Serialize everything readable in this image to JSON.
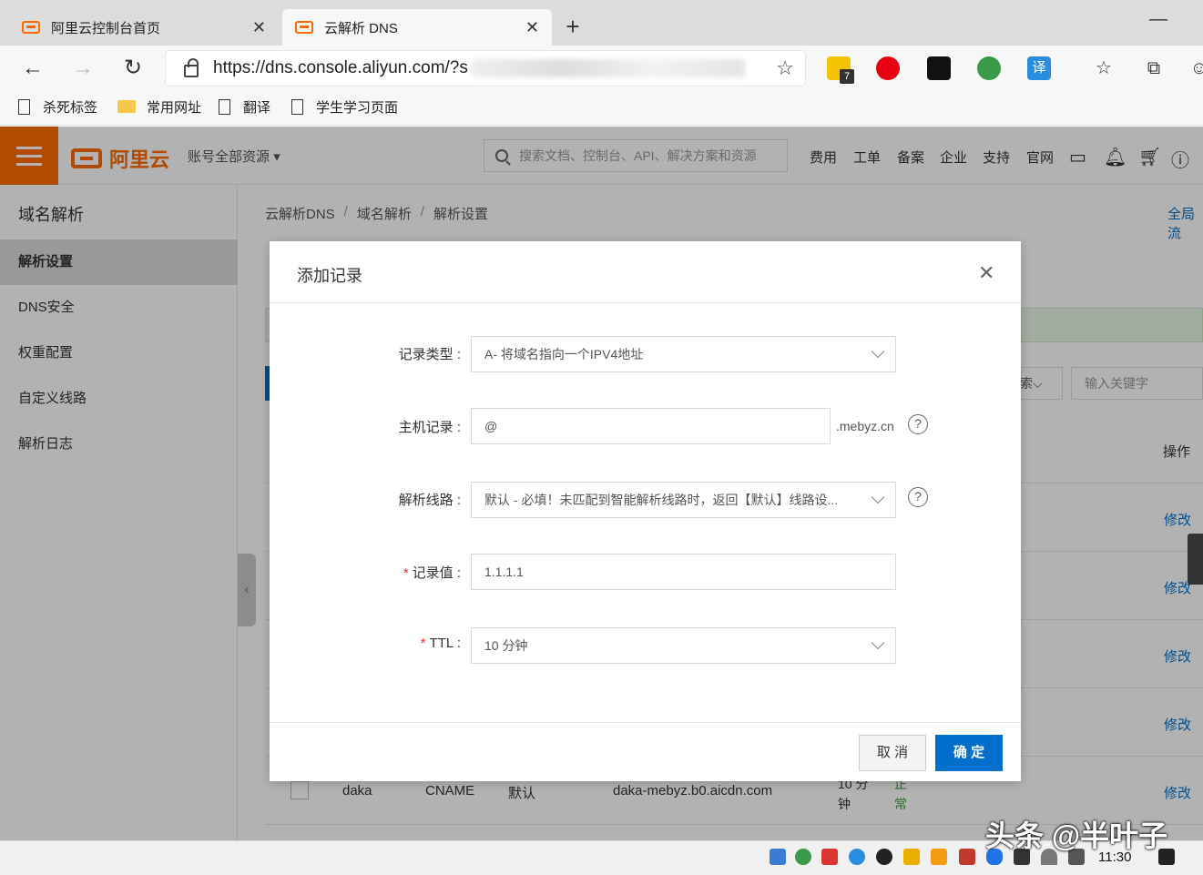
{
  "browser": {
    "tabs": [
      {
        "title": "阿里云控制台首页",
        "active": false
      },
      {
        "title": "云解析 DNS",
        "active": true
      }
    ],
    "url": "https://dns.console.aliyun.com/?s",
    "bookmarks": [
      "杀死标签",
      "常用网址",
      "翻译",
      "学生学习页面"
    ],
    "ext_badge": "7",
    "ext_translate": "译"
  },
  "console": {
    "logo": "阿里云",
    "account": "账号全部资源",
    "search_placeholder": "搜索文档、控制台、API、解决方案和资源",
    "links": [
      "费用",
      "工单",
      "备案",
      "企业",
      "支持",
      "官网"
    ]
  },
  "sidebar": {
    "title": "域名解析",
    "items": [
      {
        "label": "解析设置",
        "active": true
      },
      {
        "label": "DNS安全",
        "active": false
      },
      {
        "label": "权重配置",
        "active": false
      },
      {
        "label": "自定义线路",
        "active": false
      },
      {
        "label": "解析日志",
        "active": false
      }
    ]
  },
  "main": {
    "breadcrumb": [
      "云解析DNS",
      "域名解析",
      "解析设置"
    ],
    "quick_link": "全局流",
    "search_select": "索",
    "keyword_placeholder": "输入关键字",
    "op_header": "操作",
    "edit_label": "修改",
    "last_row": {
      "host": "daka",
      "type": "CNAME",
      "line": "默认",
      "value": "daka-mebyz.b0.aicdn.com",
      "ttl": "10 分钟",
      "status": "正常"
    }
  },
  "modal": {
    "title": "添加记录",
    "fields": {
      "record_type": {
        "label": "记录类型 :",
        "value": "A- 将域名指向一个IPV4地址"
      },
      "host": {
        "label": "主机记录 :",
        "value": "@",
        "suffix": ".mebyz.cn"
      },
      "line": {
        "label": "解析线路 :",
        "value": "默认 - 必填！未匹配到智能解析线路时，返回【默认】线路设..."
      },
      "value": {
        "label": "记录值 :",
        "value": "1.1.1.1",
        "required": "*"
      },
      "ttl": {
        "label": "TTL :",
        "value": "10 分钟",
        "required": "*"
      }
    },
    "cancel": "取 消",
    "confirm": "确 定"
  },
  "taskbar": {
    "time": "11:30"
  },
  "watermark": "头条 @半叶子"
}
